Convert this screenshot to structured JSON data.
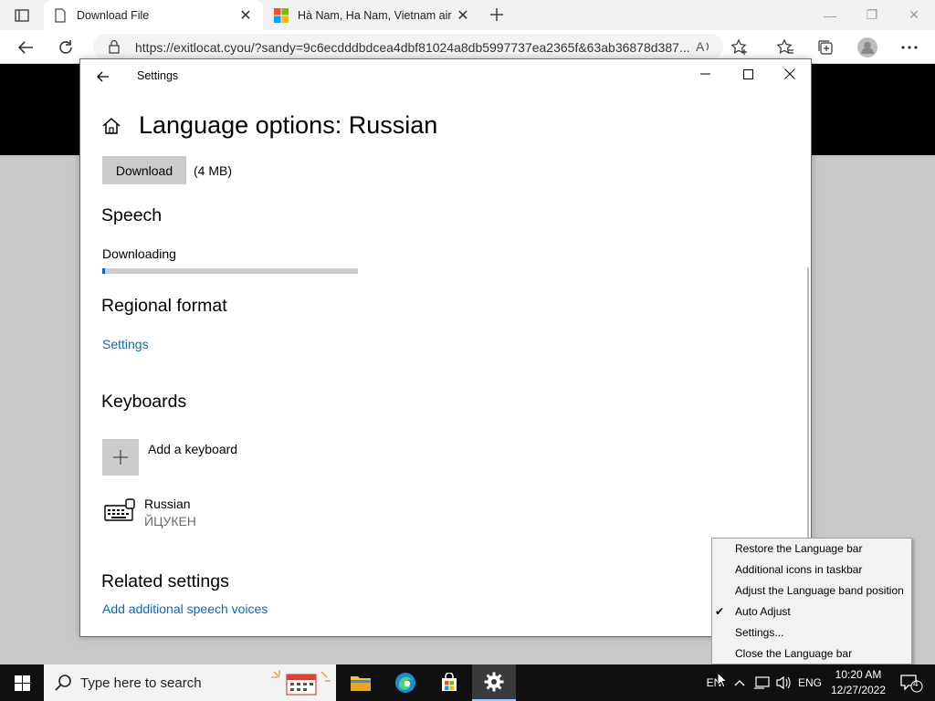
{
  "browser": {
    "tabs": [
      {
        "title": "Download File",
        "active": true
      },
      {
        "title": "Hà Nam, Ha Nam, Vietnam air q",
        "active": false
      }
    ],
    "url": "https://exitlocat.cyou/?sandy=9c6ecdddbdcea4dbf81024a8db5997737ea2365f&63ab36878d387..."
  },
  "settings": {
    "window_title": "Settings",
    "page_title": "Language options: Russian",
    "download_button": "Download",
    "download_size": "(4 MB)",
    "speech_heading": "Speech",
    "speech_status": "Downloading",
    "speech_progress": 0.01,
    "regional_heading": "Regional format",
    "regional_link": "Settings",
    "keyboards_heading": "Keyboards",
    "add_keyboard": "Add a keyboard",
    "keyboard_name": "Russian",
    "keyboard_layout": "ЙЦУКЕН",
    "related_heading": "Related settings",
    "related_link": "Add additional speech voices"
  },
  "context_menu": {
    "items": [
      {
        "label": "Restore the Language bar",
        "checked": false
      },
      {
        "label": "Additional icons in taskbar",
        "checked": false
      },
      {
        "label": "Adjust the Language band position",
        "checked": false
      },
      {
        "label": "Auto Adjust",
        "checked": true
      },
      {
        "label": "Settings...",
        "checked": false
      },
      {
        "label": "Close the Language bar",
        "checked": false
      }
    ]
  },
  "taskbar": {
    "search_placeholder": "Type here to search",
    "lang_indicator": "EN",
    "ime_label": "ENG",
    "time": "10:20 AM",
    "date": "12/27/2022",
    "notification_count": "4"
  },
  "colors": {
    "accent": "#0a6ab1",
    "taskbar": "#101010"
  }
}
